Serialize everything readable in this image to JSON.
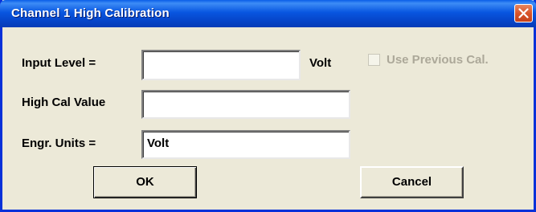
{
  "window": {
    "title": "Channel 1 High Calibration"
  },
  "form": {
    "input_level": {
      "label": "Input Level =",
      "value": "",
      "unit": "Volt"
    },
    "use_previous_cal": {
      "label": "Use Previous Cal.",
      "checked": false,
      "enabled": false
    },
    "high_cal_value": {
      "label": "High Cal Value",
      "value": ""
    },
    "engr_units": {
      "label": "Engr. Units =",
      "value": "Volt"
    }
  },
  "buttons": {
    "ok_label": "OK",
    "cancel_label": "Cancel"
  },
  "colors": {
    "titlebar": "#0856e0",
    "window_border": "#0831d9",
    "dialog_bg": "#ece9d8",
    "close_button": "#d8542a",
    "disabled_text": "#aca899"
  },
  "icons": {
    "close": "close-icon"
  }
}
